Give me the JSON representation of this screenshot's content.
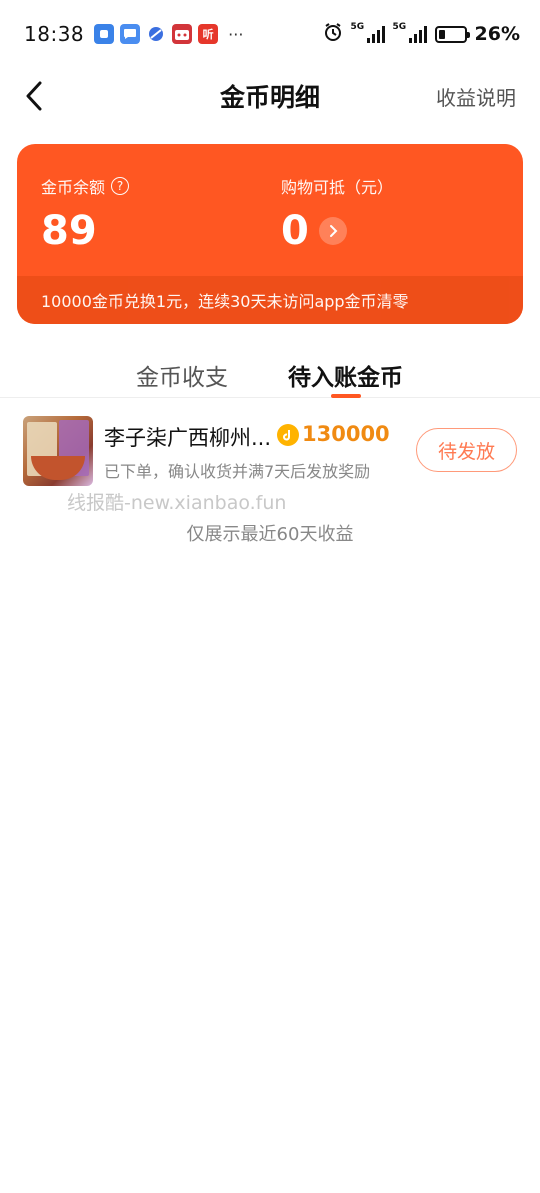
{
  "status_bar": {
    "time": "18:38",
    "app_icons": [
      "chat-app-icon",
      "message-app-icon",
      "browser-app-icon",
      "tmall-app-icon",
      "listen-app-icon"
    ],
    "listen_glyph": "听",
    "more": "···",
    "battery_percent": "26%",
    "battery_level": 0.26,
    "network_1": "5G",
    "network_2": "5G"
  },
  "header": {
    "title": "金币明细",
    "right_link": "收益说明"
  },
  "card": {
    "balance_label": "金币余额",
    "balance_value": "89",
    "deduct_label": "购物可抵（元）",
    "deduct_value": "0",
    "footer_note": "10000金币兑换1元，连续30天未访问app金币清零",
    "colors": {
      "card": "#ff5722",
      "footer": "#ee4e19"
    }
  },
  "tabs": [
    {
      "label": "金币收支",
      "active": false
    },
    {
      "label": "待入账金币",
      "active": true
    }
  ],
  "records": [
    {
      "title": "李子柒广西柳州...",
      "amount": "130000",
      "description": "已下单，确认收货并满7天后发放奖励",
      "status": "待发放"
    }
  ],
  "watermark": "线报酷-new.xianbao.fun",
  "footer_note": "仅展示最近60天收益",
  "accent_color": "#ff5722"
}
